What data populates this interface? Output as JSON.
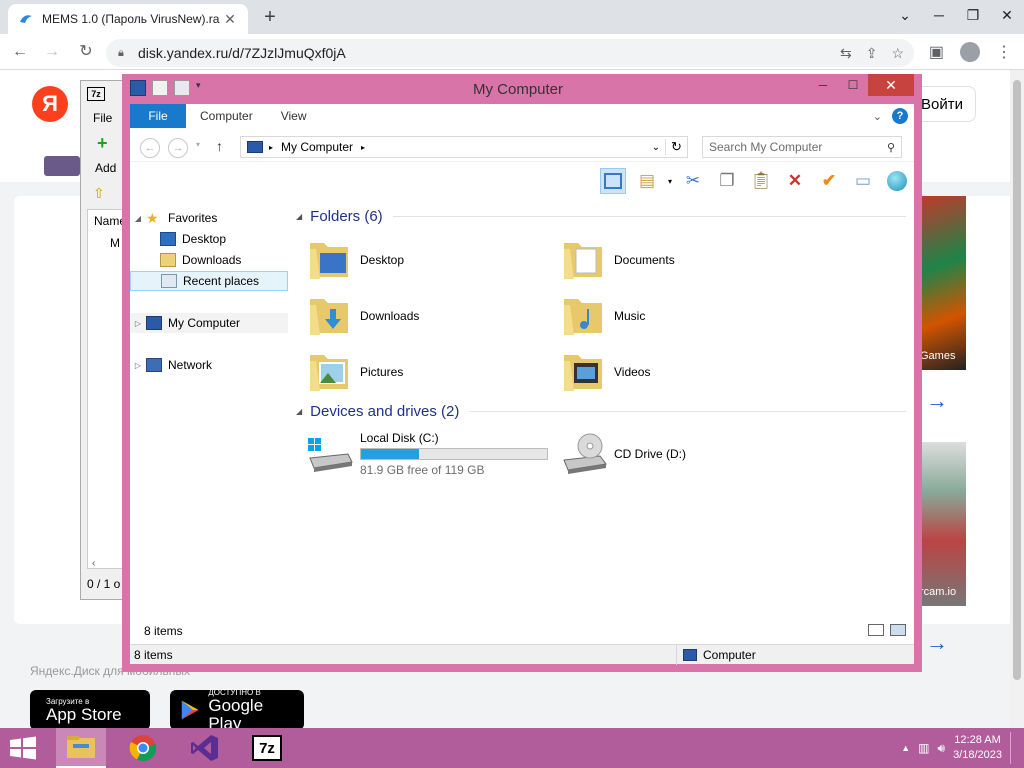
{
  "browser": {
    "tab_title": "MEMS 1.0 (Пароль VirusNew).ra",
    "tab_close": "✕",
    "new_tab": "+",
    "url": "disk.yandex.ru/d/7ZJzlJmuQxf0jA",
    "min": "─",
    "max": "❐",
    "close": "✕"
  },
  "page": {
    "logo_letter": "Я",
    "login_label": "Войти",
    "ad_label_1": "Games",
    "ad_label_2": "rcam.io",
    "mobile_text": "Яндекс.Диск для мобильных",
    "appstore_small": "Загрузите в",
    "appstore_big": "App Store",
    "gplay_small": "ДОСТУПНО В",
    "gplay_big": "Google Play"
  },
  "sevenzip": {
    "icon": "7z",
    "menu_file": "File",
    "add_label": "Add",
    "col_name": "Name",
    "row_m": "M",
    "status": "0 / 1 o"
  },
  "explorer": {
    "title": "My Computer",
    "tabs": {
      "file": "File",
      "computer": "Computer",
      "view": "View"
    },
    "address": "My Computer",
    "search_placeholder": "Search My Computer",
    "nav": {
      "favorites": "Favorites",
      "desktop": "Desktop",
      "downloads": "Downloads",
      "recent": "Recent places",
      "my_computer": "My Computer",
      "network": "Network"
    },
    "folders_header": "Folders (6)",
    "folders": [
      "Desktop",
      "Documents",
      "Downloads",
      "Music",
      "Pictures",
      "Videos"
    ],
    "drives_header": "Devices and drives (2)",
    "drive_c": {
      "name": "Local Disk (C:)",
      "free": "81.9 GB free of 119 GB",
      "used_fraction": 0.31
    },
    "drive_d": {
      "name": "CD Drive (D:)"
    },
    "items_count": "8 items",
    "status_items": "8 items",
    "status_location": "Computer"
  },
  "taskbar": {
    "sevenz_label": "7z",
    "time": "12:28 AM",
    "date": "3/18/2023"
  },
  "colors": {
    "explorer_frame": "#d974a8",
    "taskbar": "#b15c9b",
    "accent": "#1979ca",
    "drive_fill": "#26a0da"
  }
}
